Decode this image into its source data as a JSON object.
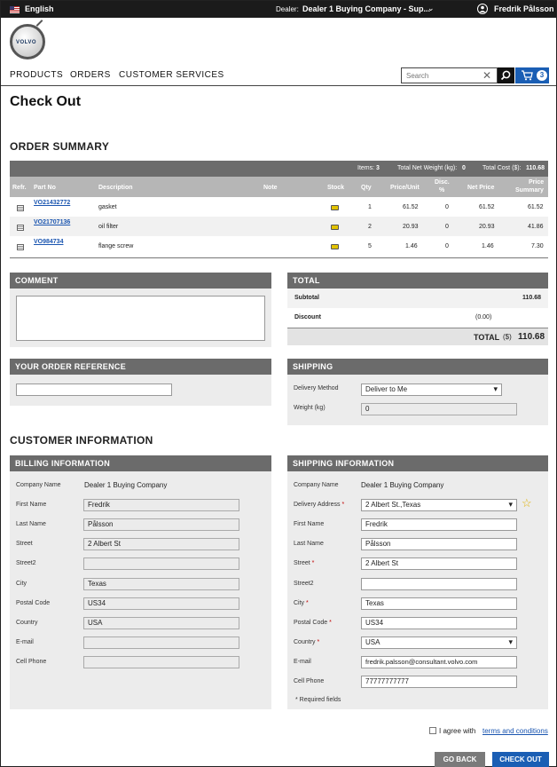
{
  "topbar": {
    "language": "English",
    "dealer_label": "Dealer:",
    "dealer_value": "Dealer 1 Buying Company - Sup...",
    "user": "Fredrik Pålsson"
  },
  "logo": {
    "text": "VOLVO"
  },
  "nav": {
    "products": "PRODUCTS",
    "orders": "ORDERS",
    "customer_services": "CUSTOMER SERVICES"
  },
  "search": {
    "placeholder": "Search",
    "clear": "✕"
  },
  "cart": {
    "count": "3"
  },
  "page_title": "Check Out",
  "order_summary": {
    "heading": "ORDER SUMMARY",
    "items_label": "Items:",
    "items_value": "3",
    "weight_label": "Total Net Weight (kg):",
    "weight_value": "0",
    "cost_label": "Total Cost ($):",
    "cost_value": "110.68",
    "columns": {
      "refr": "Refr.",
      "part_no": "Part No",
      "description": "Description",
      "note": "Note",
      "stock": "Stock",
      "qty": "Qty",
      "price_unit": "Price/Unit",
      "disc1": "Disc.",
      "disc2": "%",
      "net_price": "Net Price",
      "price_summary1": "Price",
      "price_summary2": "Summary"
    },
    "rows": [
      {
        "part_no": "VO21432772",
        "description": "gasket",
        "qty": "1",
        "price_unit": "61.52",
        "disc": "0",
        "net_price": "61.52",
        "price_summary": "61.52"
      },
      {
        "part_no": "VO21707136",
        "description": "oil filter",
        "qty": "2",
        "price_unit": "20.93",
        "disc": "0",
        "net_price": "20.93",
        "price_summary": "41.86"
      },
      {
        "part_no": "VO984734",
        "description": "flange screw",
        "qty": "5",
        "price_unit": "1.46",
        "disc": "0",
        "net_price": "1.46",
        "price_summary": "7.30"
      }
    ]
  },
  "comment": {
    "heading": "COMMENT",
    "value": ""
  },
  "total": {
    "heading": "TOTAL",
    "subtotal_label": "Subtotal",
    "subtotal_value": "110.68",
    "discount_label": "Discount",
    "discount_value": "(0.00)",
    "total_label": "TOTAL",
    "currency": "($)",
    "total_value": "110.68"
  },
  "order_reference": {
    "heading": "YOUR ORDER REFERENCE",
    "value": ""
  },
  "shipping": {
    "heading": "SHIPPING",
    "delivery_label": "Delivery Method",
    "delivery_value": "Deliver to Me",
    "weight_label": "Weight (kg)",
    "weight_value": "0"
  },
  "customer_info": {
    "heading": "CUSTOMER INFORMATION"
  },
  "billing": {
    "heading": "BILLING INFORMATION",
    "company_label": "Company Name",
    "company_value": "Dealer 1 Buying Company",
    "first_label": "First Name",
    "first_value": "Fredrik",
    "last_label": "Last Name",
    "last_value": "Pålsson",
    "street_label": "Street",
    "street_value": "2 Albert St",
    "street2_label": "Street2",
    "street2_value": "",
    "city_label": "City",
    "city_value": "Texas",
    "postal_label": "Postal Code",
    "postal_value": "US34",
    "country_label": "Country",
    "country_value": "USA",
    "email_label": "E-mail",
    "email_value": "",
    "cell_label": "Cell Phone",
    "cell_value": ""
  },
  "shipping_info": {
    "heading": "SHIPPING INFORMATION",
    "company_label": "Company Name",
    "company_value": "Dealer 1 Buying Company",
    "address_label": "Delivery Address",
    "address_value": "2 Albert St.,Texas",
    "first_label": "First Name",
    "first_value": "Fredrik",
    "last_label": "Last Name",
    "last_value": "Pålsson",
    "street_label": "Street",
    "street_value": "2 Albert St",
    "street2_label": "Street2",
    "street2_value": "",
    "city_label": "City",
    "city_value": "Texas",
    "postal_label": "Postal Code",
    "postal_value": "US34",
    "country_label": "Country",
    "country_value": "USA",
    "email_label": "E-mail",
    "email_value": "fredrik.palsson@consultant.volvo.com",
    "cell_label": "Cell Phone",
    "cell_value": "77777777777",
    "required_star": "*",
    "required_note": "* Required fields"
  },
  "agree": {
    "label": "I agree with",
    "link": "terms and conditions"
  },
  "buttons": {
    "go_back": "GO BACK",
    "check_out": "CHECK OUT"
  },
  "colors": {
    "accent": "#1a5eb4",
    "panel_header": "#6b6b6b",
    "required": "#c00000"
  }
}
